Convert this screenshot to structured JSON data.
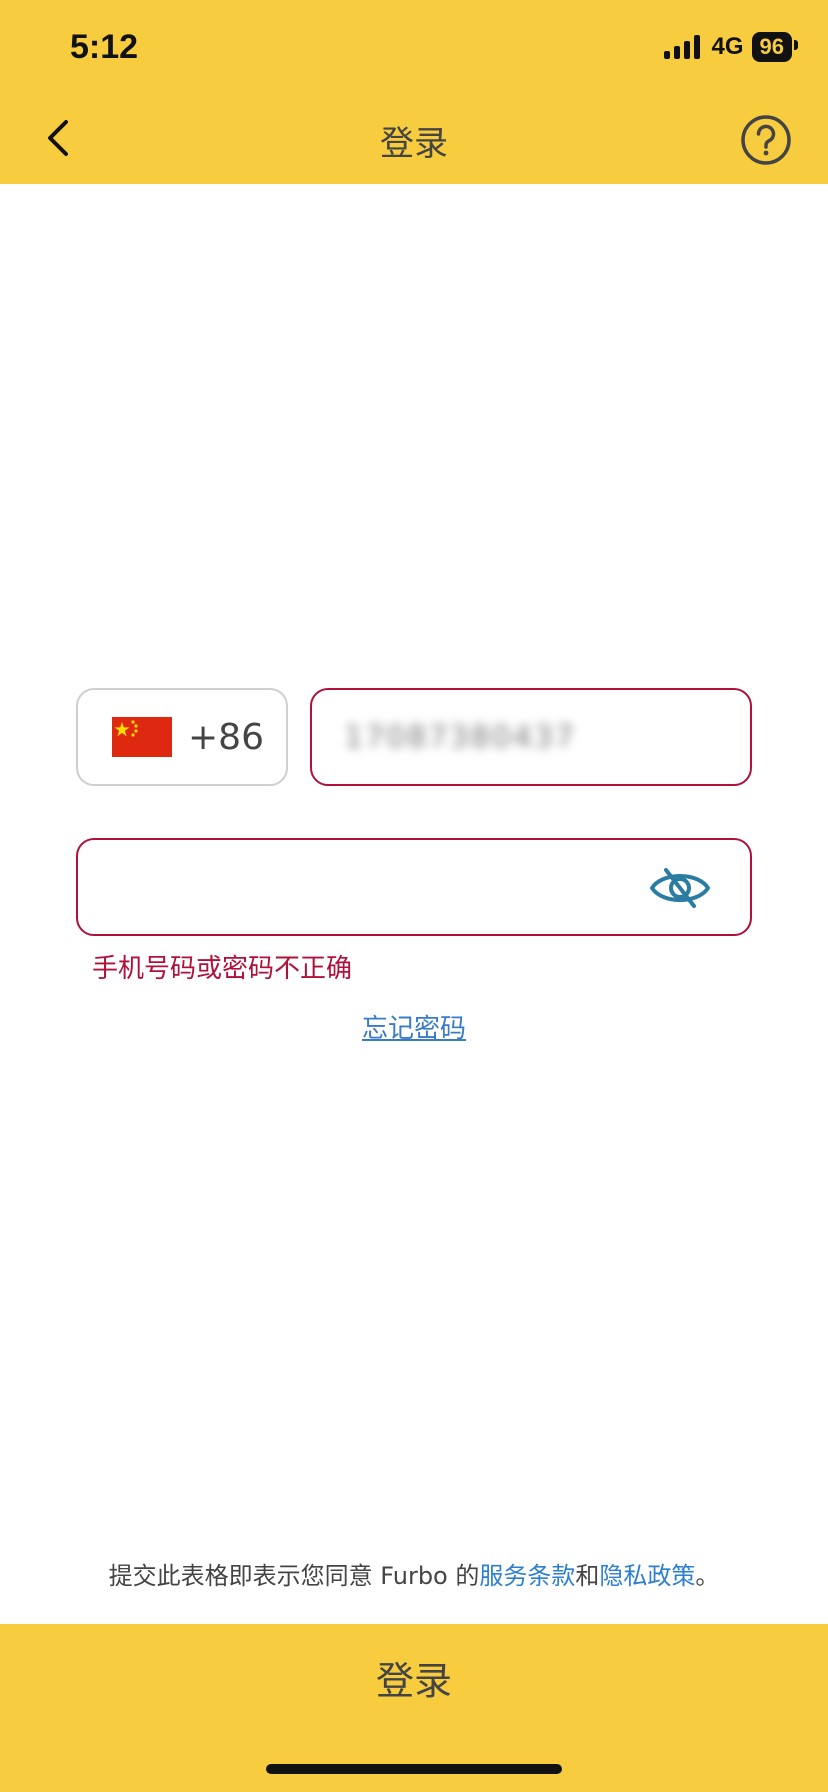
{
  "status_bar": {
    "time": "5:12",
    "network": "4G",
    "battery": "96"
  },
  "nav": {
    "title": "登录",
    "back_icon": "chevron-left-icon",
    "help_icon": "help-circle-icon"
  },
  "form": {
    "country_flag": "china-flag-icon",
    "country_code": "+86",
    "phone_value": "17087380437",
    "password_toggle_icon": "eye-slash-icon",
    "error_message": "手机号码或密码不正确",
    "forgot_password": "忘记密码"
  },
  "terms": {
    "prefix": "提交此表格即表示您同意 Furbo 的",
    "terms_link": "服务条款",
    "connector": "和",
    "privacy_link": "隐私政策",
    "suffix": "。"
  },
  "footer": {
    "login_label": "登录"
  },
  "colors": {
    "accent": "#F7CC3F",
    "error": "#B0113A",
    "link": "#2D7FD3"
  }
}
